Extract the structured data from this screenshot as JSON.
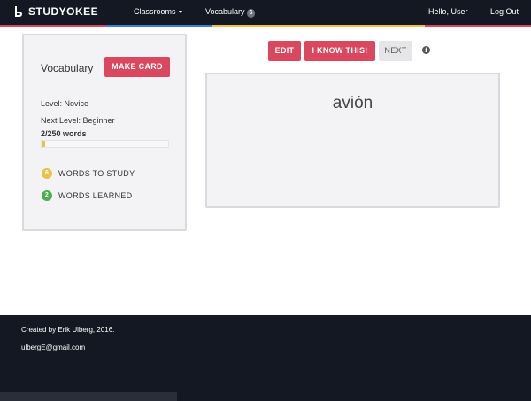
{
  "navbar": {
    "brand": "STUDYOKEE",
    "classrooms_label": "Classrooms",
    "vocabulary_label": "Vocabulary",
    "vocabulary_count": "6",
    "hello": "Hello, User",
    "logout": "Log Out"
  },
  "stripe_colors": [
    "#d9485f",
    "#3b7dd8",
    "#e8c24a",
    "#e8c24a",
    "#d9485f"
  ],
  "sidebar": {
    "title": "Vocabulary",
    "make_card": "MAKE CARD",
    "level": "Level: Novice",
    "next_level": "Next Level: Beginner",
    "words": "2/250 words",
    "progress_fraction": 0.008,
    "words_to_study_count": "6",
    "words_to_study_label": "WORDS TO STUDY",
    "words_learned_count": "2",
    "words_learned_label": "WORDS LEARNED"
  },
  "toolbar": {
    "edit": "EDIT",
    "know": "I KNOW THIS!",
    "next": "NEXT",
    "info_glyph": "i"
  },
  "card": {
    "word": "avión"
  },
  "footer": {
    "credit": "Created by Erik Ulberg, 2016.",
    "email": "ulbergE@gmail.com"
  },
  "colors": {
    "accent": "#d9485f",
    "dark": "#141822",
    "progress": "#e6c34a",
    "learned": "#4caf50"
  }
}
